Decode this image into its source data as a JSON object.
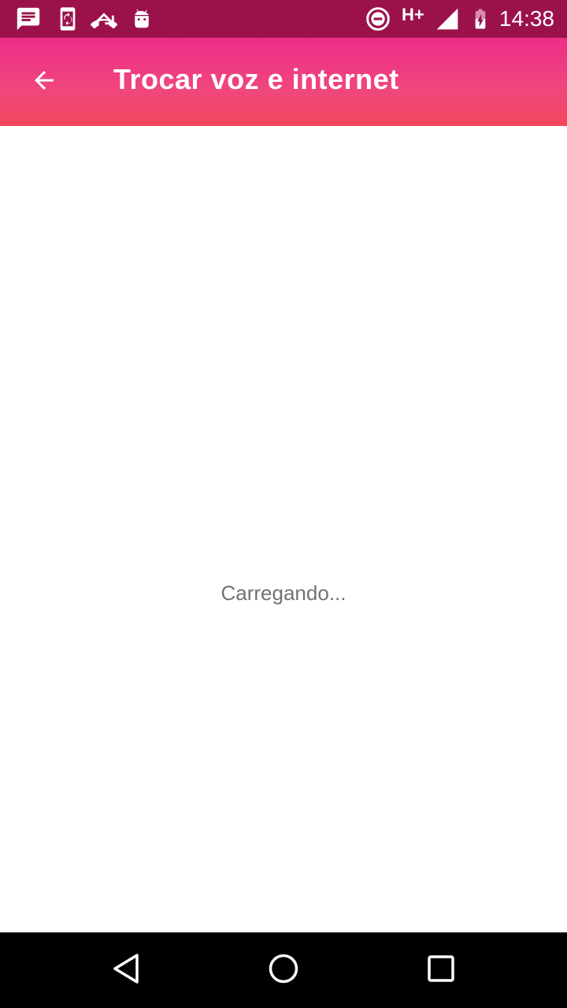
{
  "status_bar": {
    "notification_icons": [
      "message-icon",
      "phone-sync-icon",
      "missed-call-icon",
      "android-icon"
    ],
    "dnd_icon": "do-not-disturb-icon",
    "network_type": "H+",
    "signal_icon": "signal-icon",
    "battery_icon": "battery-charging-icon",
    "time": "14:38",
    "background_color": "#9b124b"
  },
  "app_bar": {
    "back_icon": "arrow-back-icon",
    "title": "Trocar voz e internet",
    "gradient_colors": [
      "#ee2d87",
      "#f2475a"
    ]
  },
  "content": {
    "loading_text": "Carregando..."
  },
  "nav_bar": {
    "buttons": [
      "back-triangle-icon",
      "home-circle-icon",
      "recents-square-icon"
    ],
    "background_color": "#000000"
  }
}
